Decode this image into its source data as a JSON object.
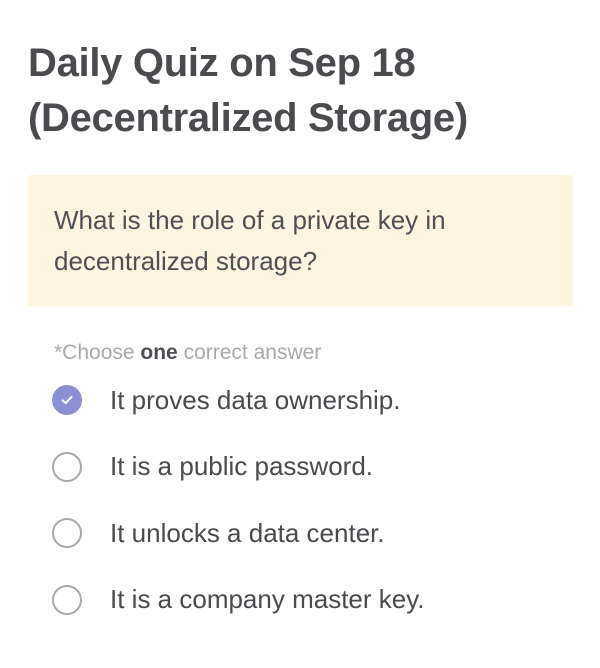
{
  "quiz": {
    "title_line1": "Daily Quiz on Sep 18",
    "title_line2": "(Decentralized Storage)"
  },
  "question": {
    "text": "What is the role of a private key in decentralized storage?"
  },
  "instruction": {
    "prefix": "*Choose ",
    "emphasis": "one",
    "suffix": " correct answer"
  },
  "options": [
    {
      "label": "It proves data ownership.",
      "selected": true
    },
    {
      "label": "It is a public password.",
      "selected": false
    },
    {
      "label": "It unlocks a data center.",
      "selected": false
    },
    {
      "label": "It is a company master key.",
      "selected": false
    }
  ],
  "colors": {
    "accent": "#8a8fd6",
    "question_background": "#fff4df",
    "text": "#4a4a4f",
    "muted_text": "#a9a9ae"
  },
  "icons": {
    "selected": "check-icon",
    "unselected": "radio-empty-icon"
  }
}
